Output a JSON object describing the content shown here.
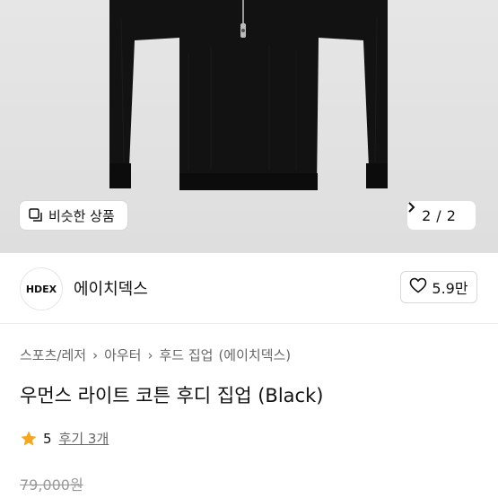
{
  "hero": {
    "image_alt": "black cropped zip-up hoodie",
    "similar_button": {
      "icon": "similar-products-icon",
      "label": "비슷한 상품"
    },
    "pager": {
      "current": "2",
      "separator": "/",
      "total": "2",
      "icon": "chevron-right-icon"
    }
  },
  "seller": {
    "logo_text": "HDEX",
    "name": "에이치덱스",
    "like_icon": "heart-icon",
    "like_count": "5.9만"
  },
  "breadcrumb": [
    "스포츠/레저",
    "아우터",
    "후드 집업",
    "(에이치덱스)"
  ],
  "product": {
    "title": "우먼스 라이트 코튼 후디 집업 (Black)",
    "rating_icon": "star-icon",
    "rating": "5",
    "reviews": "후기 3개",
    "original_price": "79,000원"
  },
  "colors": {
    "star": "#f5a623",
    "hero_bg": "#e3e3e3",
    "garment": "#111111"
  }
}
